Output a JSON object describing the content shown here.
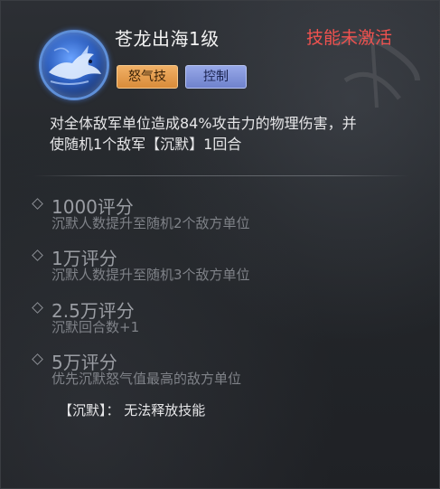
{
  "skill": {
    "name": "苍龙出海1级",
    "status": "技能未激活",
    "icon": "dragon-skill-icon",
    "tags": [
      "怒气技",
      "控制"
    ],
    "description_line1": "对全体敌军单位造成84%攻击力的物理伤害，并",
    "description_line2": "使随机1个敌军【沉默】1回合"
  },
  "upgrades": [
    {
      "title": "1000评分",
      "desc": "沉默人数提升至随机2个敌方单位"
    },
    {
      "title": "1万评分",
      "desc": "沉默人数提升至随机3个敌方单位"
    },
    {
      "title": "2.5万评分",
      "desc": "沉默回合数+1"
    },
    {
      "title": "5万评分",
      "desc": "优先沉默怒气值最高的敌方单位"
    }
  ],
  "footnote": "【沉默】：  无法释放技能",
  "colors": {
    "status_red": "#f0524f",
    "rage_tag": "#e49a4c",
    "control_tag": "#8193d9",
    "panel_bg": "#25282c"
  }
}
